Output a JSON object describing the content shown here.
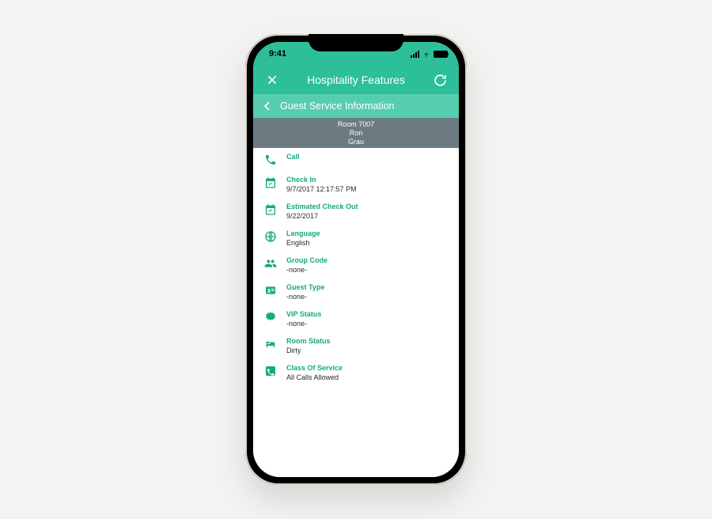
{
  "status": {
    "time": "9:41"
  },
  "header": {
    "title": "Hospitality Features"
  },
  "subheader": {
    "title": "Guest Service Information"
  },
  "room": {
    "line1": "Room 7007",
    "line2": "Ron",
    "line3": "Grau"
  },
  "items": [
    {
      "label": "Call",
      "value": ""
    },
    {
      "label": "Check In",
      "value": "9/7/2017 12:17:57 PM"
    },
    {
      "label": "Estimated Check Out",
      "value": "9/22/2017"
    },
    {
      "label": "Language",
      "value": "English"
    },
    {
      "label": "Group Code",
      "value": "-none-"
    },
    {
      "label": "Guest Type",
      "value": "-none-"
    },
    {
      "label": "VIP Status",
      "value": "-none-"
    },
    {
      "label": "Room Status",
      "value": "Dirty"
    },
    {
      "label": "Class Of Service",
      "value": "All Calls Allowed"
    }
  ]
}
